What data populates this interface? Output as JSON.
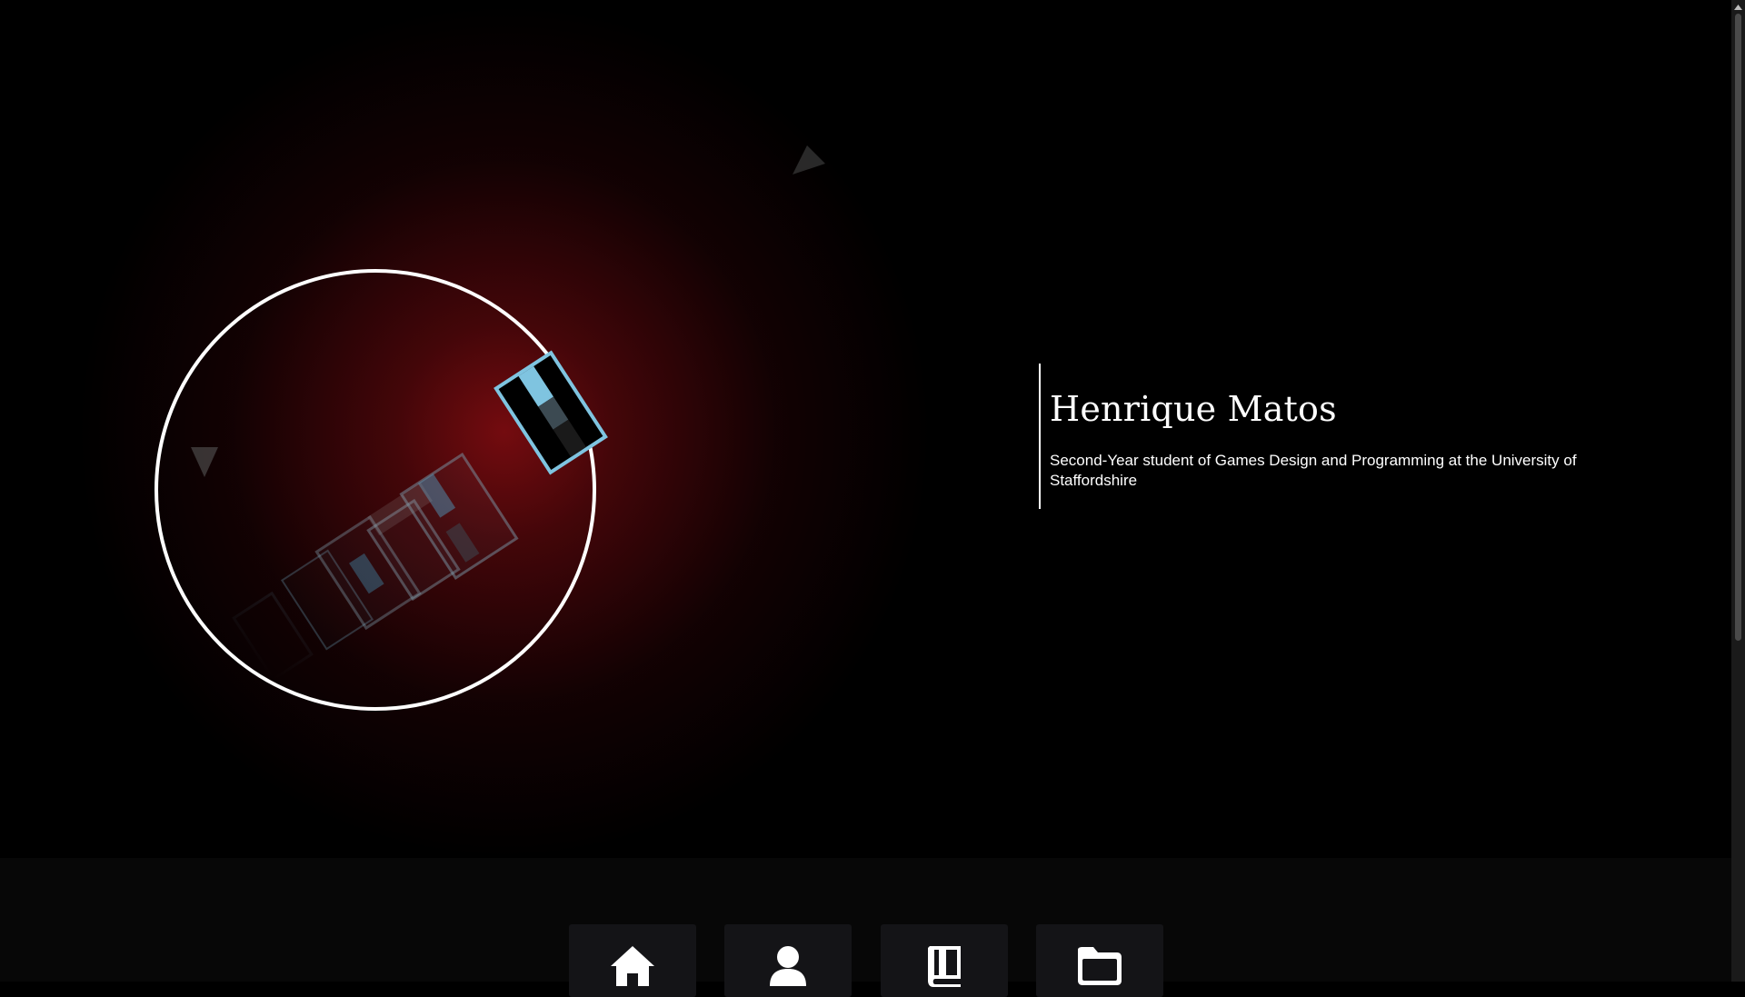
{
  "intro": {
    "name": "Henrique Matos",
    "tagline": "Second-Year student of Games Design and Programming at the University of Staffordshire"
  },
  "nav": {
    "items": [
      {
        "icon": "home-icon"
      },
      {
        "icon": "user-icon"
      },
      {
        "icon": "book-icon"
      },
      {
        "icon": "folder-icon"
      }
    ]
  },
  "colors": {
    "background": "#000000",
    "glow": "#7a0c10",
    "accent_blue": "#7fc4e0",
    "nav_bar": "#070707",
    "nav_button": "#141417",
    "text": "#ffffff"
  }
}
